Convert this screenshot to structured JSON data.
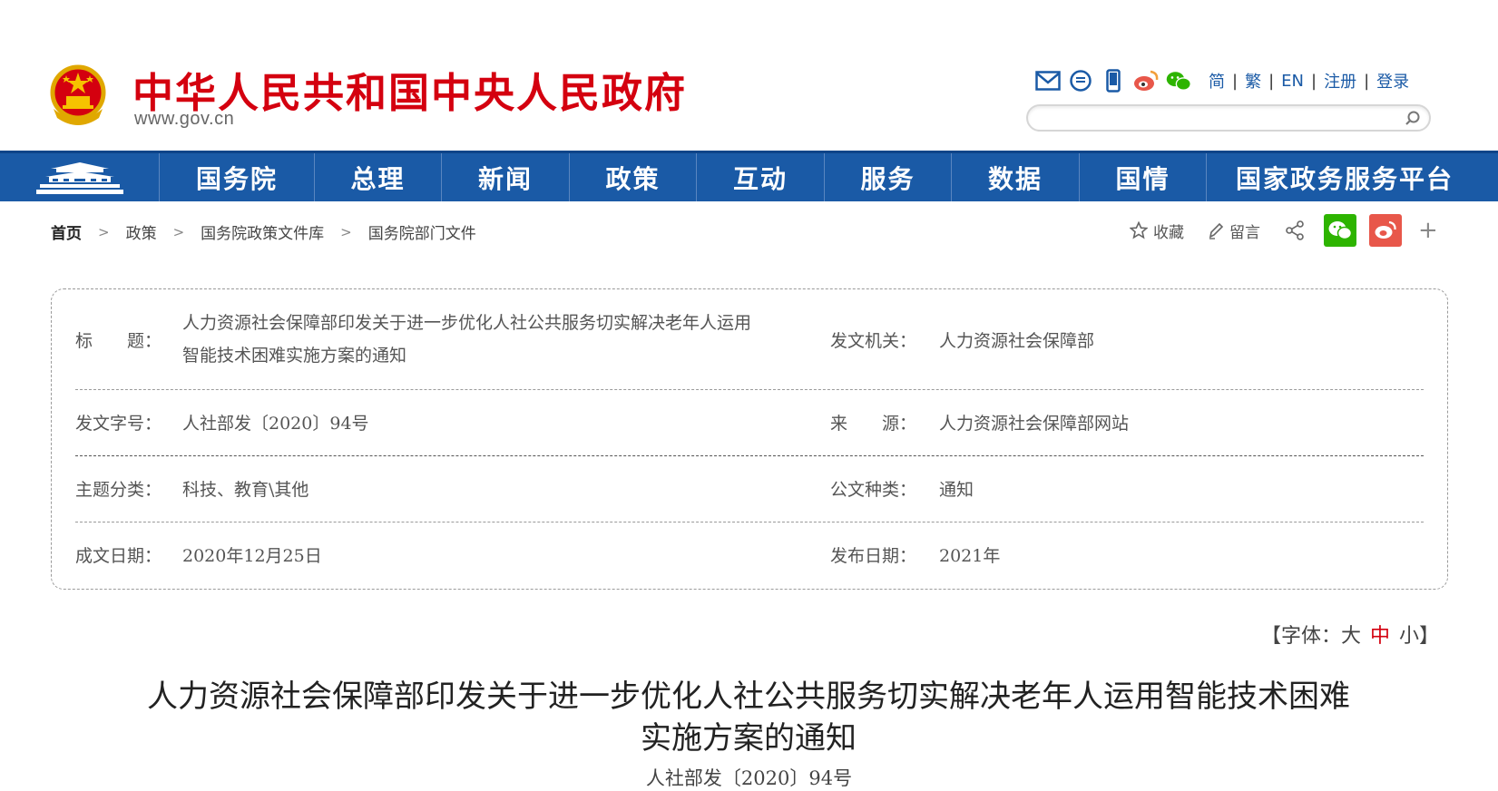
{
  "header": {
    "site_title": "中华人民共和国中央人民政府",
    "site_domain": "www.gov.cn",
    "lang_links": [
      "简",
      "繁",
      "EN",
      "注册",
      "登录"
    ],
    "search": {
      "placeholder": ""
    }
  },
  "nav": {
    "items": [
      "国务院",
      "总理",
      "新闻",
      "政策",
      "互动",
      "服务",
      "数据",
      "国情",
      "国家政务服务平台"
    ]
  },
  "breadcrumb": [
    "首页",
    "政策",
    "国务院政策文件库",
    "国务院部门文件"
  ],
  "share": {
    "collect_label": "收藏",
    "comment_label": "留言",
    "plus_label": "+"
  },
  "info": {
    "title_label": "标　　题：",
    "title_line1": "人力资源社会保障部印发关于进一步优化人社公共服务切实解决老年人运用",
    "title_line2": "智能技术困难实施方案的通知",
    "issuer_label": "发文机关：",
    "issuer_value": "人力资源社会保障部",
    "docno_label": "发文字号：",
    "docno_value": "人社部发〔2020〕94号",
    "source_label": "来　　源：",
    "source_value": "人力资源社会保障部网站",
    "topic_label": "主题分类：",
    "topic_value": "科技、教育\\其他",
    "type_label": "公文种类：",
    "type_value": "通知",
    "created_label": "成文日期：",
    "created_value": "2020年12月25日",
    "published_label": "发布日期：",
    "published_value": "2021年"
  },
  "font_size": {
    "prefix": "【字体：",
    "large": "大",
    "medium": "中",
    "small": "小",
    "suffix": "】"
  },
  "article": {
    "title_line1": "人力资源社会保障部印发关于进一步优化人社公共服务切实解决老年人运用智能技术困难",
    "title_line2": "实施方案的通知",
    "docno": "人社部发〔2020〕94号"
  },
  "colors": {
    "brand_red": "#d4000f",
    "nav_blue": "#1a5aa6",
    "link_blue": "#1a5aa6",
    "wechat_green": "#2db400",
    "weibo_red": "#e8574a"
  }
}
